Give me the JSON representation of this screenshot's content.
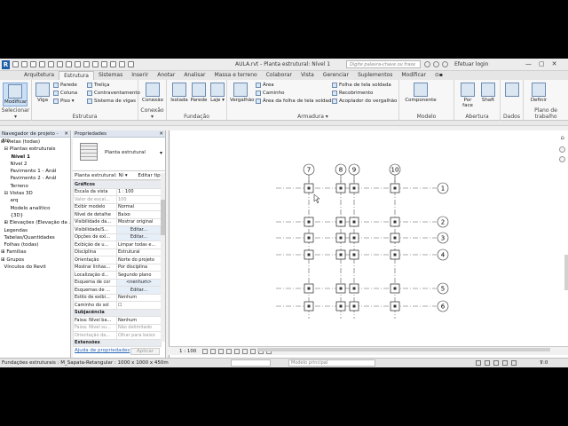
{
  "titlebar": {
    "app_logo": "R",
    "title": "AULA.rvt - Planta estrutural: Nível 1",
    "search_placeholder": "Digite palavra-chave ou frase",
    "user": "Efetuar login",
    "controls": [
      "—",
      "▢",
      "✕"
    ]
  },
  "tabs": [
    "Arquitetura",
    "Estrutura",
    "Sistemas",
    "Inserir",
    "Anotar",
    "Analisar",
    "Massa e terreno",
    "Colaborar",
    "Vista",
    "Gerenciar",
    "Suplementos",
    "Modificar",
    "⊙▪"
  ],
  "ribbon": {
    "selecionar": {
      "button": "Modificar",
      "label": "Selecionar ▾"
    },
    "estrutura": {
      "viga": "Viga",
      "items": [
        "Parede",
        "Coluna",
        "Piso ▾",
        "Treliça",
        "Contraventamento",
        "Sistema de vigas"
      ],
      "label": "Estrutura"
    },
    "conexao": {
      "button": "Conexão",
      "label": "Conexão ▾"
    },
    "fundacao": {
      "buttons": [
        "Isolada",
        "Parede",
        "Laje ▾"
      ],
      "label": "Fundação"
    },
    "armadura": {
      "vergalhao": "Vergalhão",
      "items": [
        "Área",
        "Caminho",
        "Área da folha de tela soldada",
        "Folha de tela soldada",
        "Recobrimento",
        "Acoplador do vergalhão"
      ],
      "label": "Armadura ▾"
    },
    "modelo": {
      "button": "Componente",
      "label": "Modelo"
    },
    "abertura": {
      "buttons": [
        "Por face",
        "Shaft"
      ],
      "label": "Abertura"
    },
    "dados": {
      "label": "Dados"
    },
    "plano": {
      "button": "Definir",
      "label": "Plano de trabalho"
    }
  },
  "browser": {
    "title": "Navegador de projeto - AU...",
    "items": [
      "⊟ Vistas (todas)",
      "  ⊟ Plantas estruturais",
      "      Nível 1",
      "      Nível 2",
      "      Pavimento 1 - Anál",
      "      Pavimento 2 - Anál",
      "      Terreno",
      "  ⊟ Vistas 3D",
      "      arq",
      "      Modelo analítico",
      "      {3D}",
      "  ⊞ Elevações (Elevação da ...",
      "  Legendas",
      "  Tabelas/Quantidades",
      "  Folhas (todas)",
      "⊞ Famílias",
      "⊞ Grupos",
      "  Vínculos do Revit"
    ]
  },
  "properties": {
    "title": "Propriedades",
    "type_name": "Planta estrutural",
    "filter": "Planta estrutural: Ní ▾",
    "edit_type": "Editar tipo",
    "rows": [
      {
        "section": "Gráficos"
      },
      {
        "k": "Escala da vista",
        "v": "1 : 100"
      },
      {
        "k": "Valor de escal...",
        "v": "100",
        "dim": true
      },
      {
        "k": "Exibir modelo",
        "v": "Normal"
      },
      {
        "k": "Nível de detalhe",
        "v": "Baixo"
      },
      {
        "k": "Visibilidade da...",
        "v": "Mostrar original"
      },
      {
        "k": "Visibilidade/S...",
        "v": "Editar...",
        "btn": true
      },
      {
        "k": "Opções de exi...",
        "v": "Editar...",
        "btn": true
      },
      {
        "k": "Exibição de u...",
        "v": "Limpar todas e..."
      },
      {
        "k": "Disciplina",
        "v": "Estrutural"
      },
      {
        "k": "Orientação",
        "v": "Norte do projeto"
      },
      {
        "k": "Mostrar linhas...",
        "v": "Por disciplina"
      },
      {
        "k": "Localização d...",
        "v": "Segundo plano"
      },
      {
        "k": "Esquema de cor",
        "v": "<nenhum>",
        "btn": true
      },
      {
        "k": "Esquemas de ...",
        "v": "Editar...",
        "btn": true
      },
      {
        "k": "Estilo de exibi...",
        "v": "Nenhum"
      },
      {
        "k": "Caminho do sol",
        "v": "☐"
      },
      {
        "section": "Subjacência"
      },
      {
        "k": "Faixa: Nível ba...",
        "v": "Nenhum"
      },
      {
        "k": "Faixa: Nível su...",
        "v": "Não delimitado",
        "dim": true
      },
      {
        "k": "Orientação da...",
        "v": "Olhar para baixo",
        "dim": true
      },
      {
        "section": "Extensões"
      }
    ],
    "help_link": "Ajuda de propriedades",
    "apply": "Aplicar"
  },
  "canvas": {
    "grid_cols": [
      "7",
      "8",
      "9",
      "10"
    ],
    "grid_rows": [
      "1",
      "2",
      "3",
      "4",
      "5",
      "6"
    ]
  },
  "viewbar": {
    "scale": "1 : 100"
  },
  "statusbar": {
    "message": "Fundações estruturais : M_Sapata-Retangular : 1000 x 1000 x 450m",
    "model": "Modelo principal",
    "filter": "⊽:0"
  }
}
